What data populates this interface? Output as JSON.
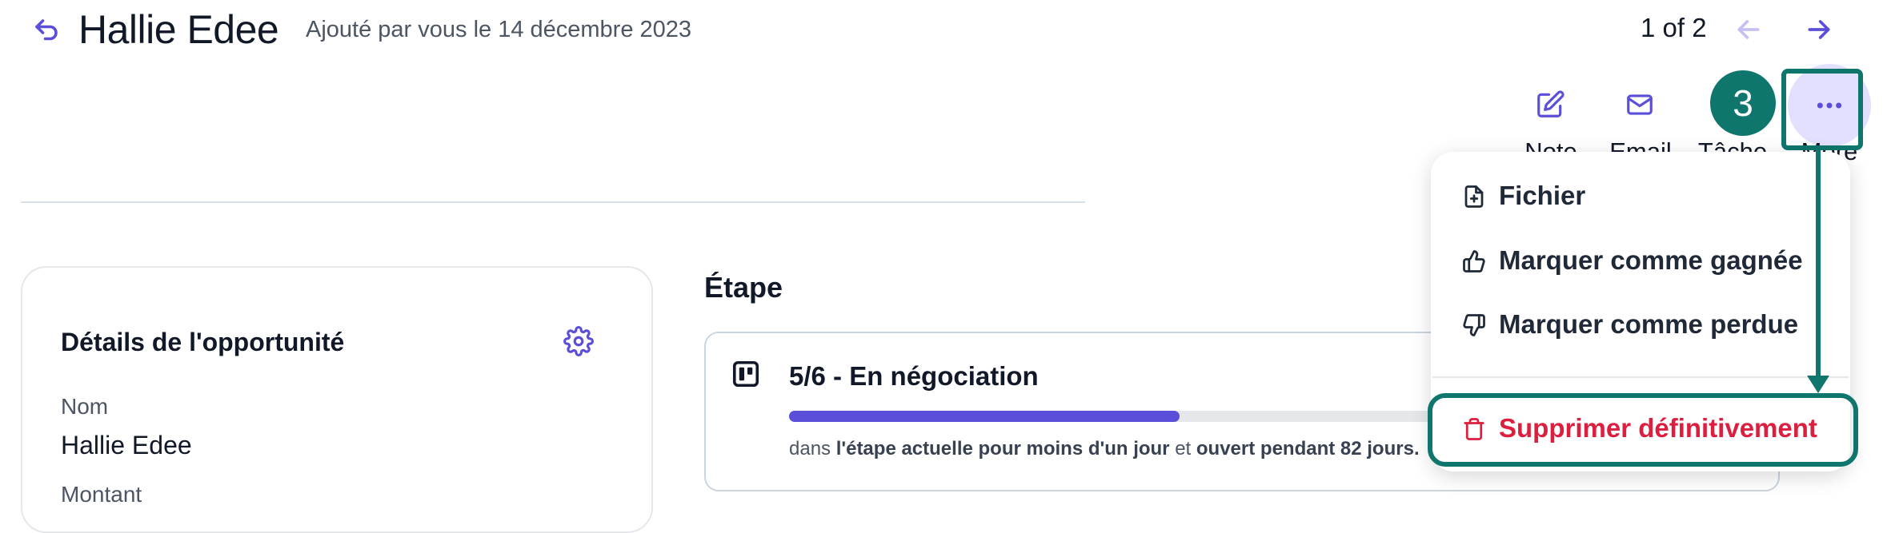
{
  "header": {
    "title": "Hallie Edee",
    "added_text": "Ajouté par vous le 14 décembre 2023",
    "pager": "1 of 2"
  },
  "actions": {
    "note_label": "Note",
    "email_label": "Email",
    "task_label": "Tâche",
    "more_label": "More"
  },
  "annotation": {
    "step_number": "3"
  },
  "details": {
    "title": "Détails de l'opportunité",
    "nom_label": "Nom",
    "nom_value": "Hallie Edee",
    "montant_label": "Montant"
  },
  "stage": {
    "heading": "Étape",
    "title": "5/6 - En négociation",
    "progress": 0.4,
    "desc_prefix": "dans ",
    "desc_bold1": "l'étape actuelle pour moins d'un jour",
    "desc_middle": " et ",
    "desc_bold2": "ouvert pendant 82 jours."
  },
  "menu": {
    "items": [
      {
        "label": "Fichier",
        "icon": "file-plus-icon"
      },
      {
        "label": "Marquer comme gagnée",
        "icon": "thumbs-up-icon"
      },
      {
        "label": "Marquer comme perdue",
        "icon": "thumbs-down-icon"
      }
    ],
    "delete_label": "Supprimer définitivement"
  },
  "colors": {
    "accent": "#5b4fd9",
    "accent_light": "#e3e0ff",
    "annotation": "#0f766e",
    "danger": "#dc1f3f"
  }
}
